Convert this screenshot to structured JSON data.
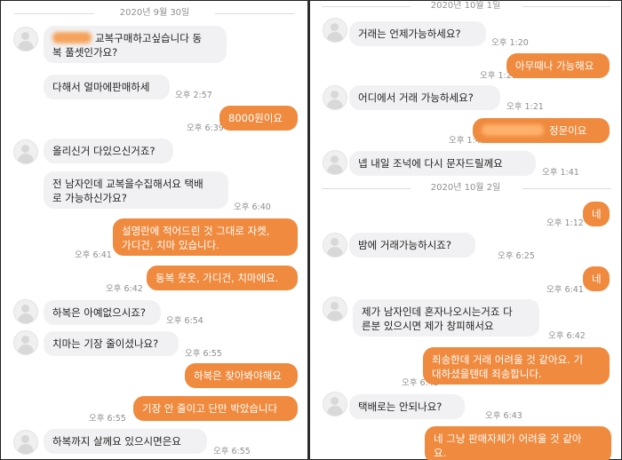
{
  "left": {
    "date": "2020년 9월 30일",
    "messages": [
      {
        "dir": "in",
        "text": "교복구매하고싶습니다 동\n복 풀셋인가요?",
        "redacted": true
      },
      {
        "dir": "in",
        "text": "다해서 얼마에판매하세",
        "time": "오후 2:57"
      },
      {
        "dir": "out",
        "text": "8000원이요",
        "time": "오후 6:39"
      },
      {
        "dir": "in",
        "text": "올리신거 다있으신거죠?"
      },
      {
        "dir": "in",
        "text": "전 남자인데 교복을수집해서요 택배\n로 가능하신가요?",
        "time": "오후 6:40"
      },
      {
        "dir": "out",
        "text": "설명란에 적어드린 것 그대로 자켓,\n가디건, 치마 있습니다.",
        "time": "오후 6:41"
      },
      {
        "dir": "out",
        "text": "동복 웃옷, 가디건, 치마에요.",
        "time": "오후 6:42"
      },
      {
        "dir": "in",
        "text": "하복은 아예없으시죠?",
        "time": "오후 6:54"
      },
      {
        "dir": "in",
        "text": "치마는 기장 줄이셨나요?",
        "time": "오후 6:55"
      },
      {
        "dir": "out",
        "text": "하복은 찾아봐야해요"
      },
      {
        "dir": "out",
        "text": "기장 안 줄이고 단만 박았습니다",
        "time": "오후 6:55"
      },
      {
        "dir": "in",
        "text": "하복까지 살께요 있으시면은요",
        "time": "오후 6:55"
      }
    ]
  },
  "right": {
    "date1": "2020년 10월 1일",
    "date2": "2020년 10월 2일",
    "messages": [
      {
        "dir": "in",
        "text": "거래는 언제가능하세요?",
        "time": "오후 1:20"
      },
      {
        "dir": "out",
        "text": "아무때나 가능해요",
        "time": "오후 1:20"
      },
      {
        "dir": "in",
        "text": "어디에서 거래 가능하세요?",
        "time": "오후 1:21"
      },
      {
        "dir": "out",
        "text": "정문이요",
        "time": "오후 1:40",
        "redacted": true
      },
      {
        "dir": "in",
        "text": "넵 내일 조넉에 다시 문자드릴께요",
        "time": "오후 1:41"
      },
      {
        "dir": "out",
        "text": "네",
        "time": "오후 1:12"
      },
      {
        "dir": "in",
        "text": "밤에 거래가능하시죠?",
        "time": "오후 6:25"
      },
      {
        "dir": "out",
        "text": "네",
        "time": "오후 6:41"
      },
      {
        "dir": "in",
        "text": "제가 남자인데 혼자나오시는거죠 다\n른분 있으시면 제가 창피해서요",
        "time": "오후 6:42"
      },
      {
        "dir": "out",
        "text": "죄송한데 거래 어려울 것 같아요. 기\n대하셨을텐데 죄송합니다.",
        "time": "오후 6:43"
      },
      {
        "dir": "in",
        "text": "택배로는 안되나요?",
        "time": "오후 6:43"
      },
      {
        "dir": "out",
        "text": "네 그냥 판매자체가 어려울 것 같아\n요."
      }
    ]
  }
}
